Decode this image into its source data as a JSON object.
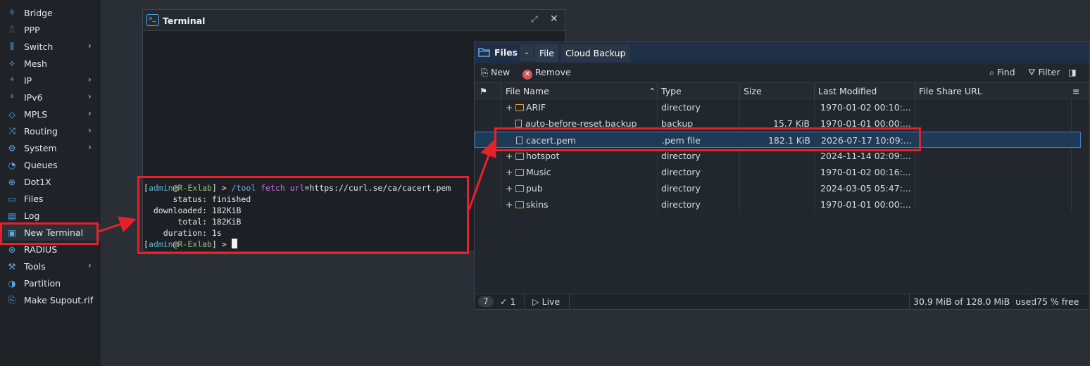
{
  "sidebar": {
    "items": [
      {
        "label": "Bridge",
        "icon": "bridge-icon",
        "submenu": false
      },
      {
        "label": "PPP",
        "icon": "ppp-icon",
        "submenu": false
      },
      {
        "label": "Switch",
        "icon": "switch-icon",
        "submenu": true
      },
      {
        "label": "Mesh",
        "icon": "mesh-icon",
        "submenu": false
      },
      {
        "label": "IP",
        "icon": "ip-icon",
        "submenu": true
      },
      {
        "label": "IPv6",
        "icon": "ipv6-icon",
        "submenu": true
      },
      {
        "label": "MPLS",
        "icon": "mpls-icon",
        "submenu": true
      },
      {
        "label": "Routing",
        "icon": "routing-icon",
        "submenu": true
      },
      {
        "label": "System",
        "icon": "gear-icon",
        "submenu": true
      },
      {
        "label": "Queues",
        "icon": "queues-icon",
        "submenu": false
      },
      {
        "label": "Dot1X",
        "icon": "dot1x-icon",
        "submenu": false
      },
      {
        "label": "Files",
        "icon": "folder-icon",
        "submenu": false
      },
      {
        "label": "Log",
        "icon": "log-icon",
        "submenu": false
      },
      {
        "label": "New Terminal",
        "icon": "terminal-icon",
        "submenu": false
      },
      {
        "label": "RADIUS",
        "icon": "radius-icon",
        "submenu": false
      },
      {
        "label": "Tools",
        "icon": "tools-icon",
        "submenu": true
      },
      {
        "label": "Partition",
        "icon": "partition-icon",
        "submenu": false
      },
      {
        "label": "Make Supout.rif",
        "icon": "supout-icon",
        "submenu": false
      }
    ]
  },
  "terminal": {
    "title": "Terminal",
    "lines": {
      "l1_open": "[",
      "l1_user": "admin",
      "l1_at": "@",
      "l1_host": "R-Exlab",
      "l1_close": "] > ",
      "l1_cmd": "/tool ",
      "l1_sub": "fetch ",
      "l1_param": "url",
      "l1_val": "=https://curl.se/ca/cacert.pem",
      "l2": "      status: finished",
      "l3": "  downloaded: 182KiB",
      "l4": "       total: 182KiB",
      "l5": "    duration: 1s",
      "l6_open": "[",
      "l6_user": "admin",
      "l6_at": "@",
      "l6_host": "R-Exlab",
      "l6_close": "] > "
    }
  },
  "files": {
    "title": "Files",
    "tabs": [
      "File",
      "Cloud Backup"
    ],
    "toolbar": {
      "new": "New",
      "remove": "Remove",
      "find": "Find",
      "filter": "Filter"
    },
    "columns": [
      "File Name",
      "Type",
      "Size",
      "Last Modified",
      "File Share URL"
    ],
    "rows": [
      {
        "expand": "+",
        "kind": "folder",
        "name": "ARIF",
        "type": "directory",
        "size": "",
        "modified": "1970-01-02 00:10:..."
      },
      {
        "expand": "",
        "kind": "file",
        "name": "auto-before-reset.backup",
        "type": "backup",
        "size": "15.7 KiB",
        "modified": "1970-01-01 00:00:..."
      },
      {
        "expand": "",
        "kind": "file",
        "name": "cacert.pem",
        "type": ".pem file",
        "size": "182.1 KiB",
        "modified": "2026-07-17 10:09:..."
      },
      {
        "expand": "+",
        "kind": "folder",
        "name": "hotspot",
        "type": "directory",
        "size": "",
        "modified": "2024-11-14 02:09:..."
      },
      {
        "expand": "+",
        "kind": "folder",
        "name": "Music",
        "type": "directory",
        "size": "",
        "modified": "1970-01-02 00:16:..."
      },
      {
        "expand": "+",
        "kind": "folder",
        "name": "pub",
        "type": "directory",
        "size": "",
        "modified": "2024-03-05 05:47:..."
      },
      {
        "expand": "+",
        "kind": "folder",
        "name": "skins",
        "type": "directory",
        "size": "",
        "modified": "1970-01-01 00:00:..."
      }
    ],
    "status": {
      "count": "7",
      "selected": "1",
      "live": "Live",
      "usage": "30.9 MiB of 128.0 MiB  used",
      "free": "75 % free"
    }
  },
  "colors": {
    "accent": "#5aa6e8",
    "annotation": "#e8202a",
    "folder": "#e6a23c",
    "selected_row": "#1e3a57"
  }
}
